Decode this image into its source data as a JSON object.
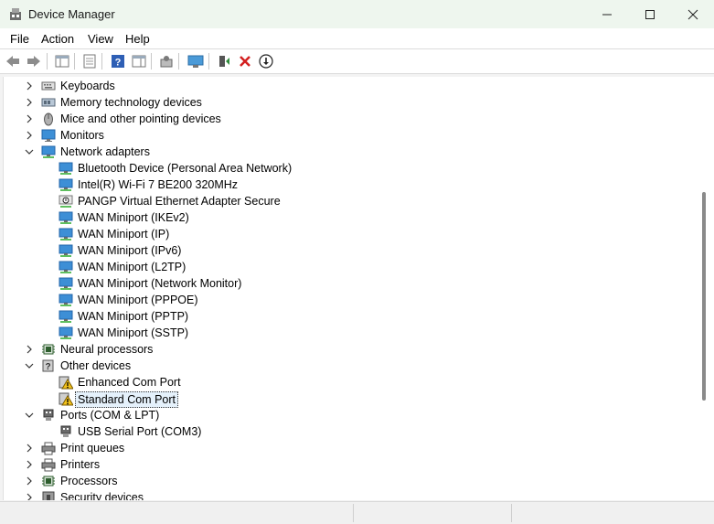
{
  "window": {
    "title": "Device Manager"
  },
  "menu": {
    "file": "File",
    "action": "Action",
    "view": "View",
    "help": "Help"
  },
  "toolbar": {
    "buttons": [
      "back-icon",
      "forward-icon",
      "show-hide-console-tree-icon",
      "properties-icon",
      "help-icon",
      "action-pane-icon",
      "update-driver-icon",
      "scan-hardware-icon",
      "enable-device-icon",
      "uninstall-device-icon",
      "download-driver-icon"
    ]
  },
  "tree": {
    "keyboards": "Keyboards",
    "memory": "Memory technology devices",
    "mice": "Mice and other pointing devices",
    "monitors": "Monitors",
    "network": "Network adapters",
    "net_children": [
      "Bluetooth Device (Personal Area Network)",
      "Intel(R) Wi-Fi 7 BE200 320MHz",
      "PANGP Virtual Ethernet Adapter Secure",
      "WAN Miniport (IKEv2)",
      "WAN Miniport (IP)",
      "WAN Miniport (IPv6)",
      "WAN Miniport (L2TP)",
      "WAN Miniport (Network Monitor)",
      "WAN Miniport (PPPOE)",
      "WAN Miniport (PPTP)",
      "WAN Miniport (SSTP)"
    ],
    "neural": "Neural processors",
    "other": "Other devices",
    "other_children": [
      "Enhanced Com Port",
      "Standard Com Port"
    ],
    "ports": "Ports (COM & LPT)",
    "ports_children": [
      "USB Serial Port (COM3)"
    ],
    "printqueues": "Print queues",
    "printers": "Printers",
    "processors": "Processors",
    "security": "Security devices"
  },
  "colors": {
    "titlebar": "#eef6ee",
    "selection": "#e5f1fb",
    "uninstall": "#d32020",
    "update": "#2e8b3a"
  }
}
